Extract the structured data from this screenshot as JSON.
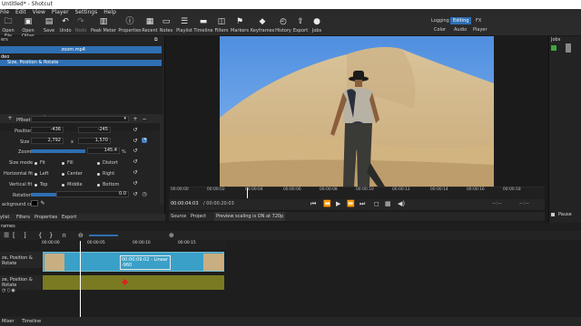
{
  "window": {
    "title": "Untitled* - Shotcut"
  },
  "menu": {
    "items": [
      "File",
      "Edit",
      "View",
      "Player",
      "Settings",
      "Help"
    ]
  },
  "toolbar": {
    "buttons": [
      "Open File",
      "Open Other",
      "Save",
      "Undo",
      "Redo",
      "Peak Meter",
      "Properties",
      "Recent",
      "Notes",
      "Playlist",
      "Timeline",
      "Filters",
      "Markers",
      "Keyframes",
      "History",
      "Export",
      "Jobs"
    ],
    "layouts": {
      "logging": "Logging",
      "editing": "Editing",
      "fx": "FX",
      "color": "Color",
      "audio": "Audio",
      "player": "Player"
    }
  },
  "filters_panel": {
    "header_label": "ers",
    "clip_name": "zoom.mp4",
    "section_label": "deo",
    "selected_filter": "Size, Position & Rotate",
    "preset_label": "Preset",
    "position_label": "Position",
    "position_x": "-436",
    "position_y": "-245",
    "size_label": "Size",
    "size_w": "2,792",
    "size_h": "1,570",
    "size_sep": "x",
    "zoom_label": "Zoom",
    "zoom_value": "145.4",
    "zoom_unit": "%",
    "size_mode_label": "Size mode",
    "size_mode_options": [
      "Fit",
      "Fill",
      "Distort"
    ],
    "hfit_label": "Horizontal fit",
    "hfit_options": [
      "Left",
      "Center",
      "Right"
    ],
    "vfit_label": "Vertical fit",
    "vfit_options": [
      "Top",
      "Middle",
      "Bottom"
    ],
    "rotation_label": "Rotation",
    "rotation_value": "0.0",
    "bgcolor_label": "ackground color"
  },
  "left_tabs": [
    "ylist",
    "Filters",
    "Properties",
    "Export"
  ],
  "viewer": {
    "ticks": [
      "00:00:00",
      "00:00:02",
      "00:00:04",
      "00:00:06",
      "00:00:08",
      "00:00:10",
      "00:00:12",
      "00:00:14",
      "00:00:16",
      "00:00:18"
    ],
    "timecode": "00:00:04:03",
    "duration": "/ 00:00:20:03",
    "tabs": {
      "source": "Source",
      "project": "Project"
    },
    "scaling_notice": "Preview scaling is ON at 720p"
  },
  "jobs": {
    "title": "Jobs",
    "pause": "Pause"
  },
  "timeline": {
    "header": "rames",
    "ticks": [
      "00:00:00",
      "00:00:05",
      "00:00:10",
      "00:00:15"
    ],
    "track_label": "ze, Position & Rotate",
    "track2_label": "ze, Position & Rotate",
    "tooltip_line1": "00:00:09:02 - Linear",
    "tooltip_line2": "-960"
  },
  "status": {
    "tabs": [
      "Mixer",
      "Timeline"
    ]
  },
  "colors": {
    "accent": "#2f6fb3",
    "clip": "#3aa0c8",
    "keyframe_track": "#7a7a22",
    "keyframe": "#e02020"
  }
}
